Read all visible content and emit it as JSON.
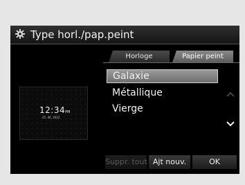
{
  "window": {
    "title": "Type horl./pap.peint",
    "title_icon": "gear-icon"
  },
  "tabs": [
    {
      "label": "Horloge",
      "selected": false
    },
    {
      "label": "Papier peint",
      "selected": true
    }
  ],
  "preview": {
    "time": "12:34",
    "ampm": "PM",
    "date": "25. 06. 2012"
  },
  "list": {
    "items": [
      {
        "label": "Galaxie",
        "selected": true
      },
      {
        "label": "Métallique",
        "selected": false
      },
      {
        "label": "Vierge",
        "selected": false
      }
    ],
    "scroll_up_icon": "chevron-up-icon",
    "scroll_down_icon": "chevron-down-icon"
  },
  "buttons": {
    "delete_all": "Suppr. tout",
    "add_new": "Ajt nouv.",
    "ok": "OK"
  },
  "colors": {
    "screen_background": "#000000",
    "frame_background": "#e6e6e6",
    "selected_item": "#8a8a8a"
  }
}
